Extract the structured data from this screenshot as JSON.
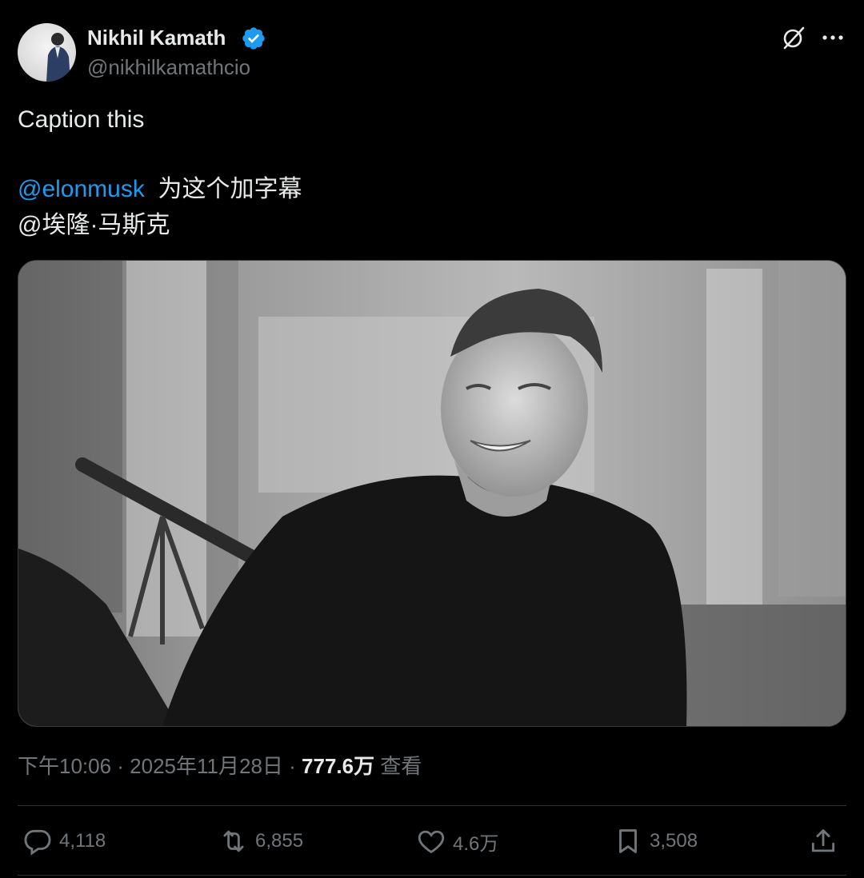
{
  "author": {
    "name": "Nikhil Kamath",
    "handle": "@nikhilkamathcio",
    "verified": true
  },
  "tweet": {
    "line1": "Caption this",
    "mention": "@elonmusk",
    "translation": "为这个加字幕",
    "line3": "@埃隆·马斯克"
  },
  "meta": {
    "time": "下午10:06 · 2025年11月28日 · ",
    "views": "777.6万",
    "views_label": " 查看"
  },
  "actions": {
    "replies": "4,118",
    "reposts": "6,855",
    "likes": "4.6万",
    "bookmarks": "3,508"
  },
  "colors": {
    "background": "#000000",
    "text": "#e7e9ea",
    "muted": "#71767b",
    "accent": "#1d9bf0",
    "divider": "#2f3336"
  },
  "icons": [
    "grok-icon",
    "more-icon",
    "verified-badge-icon",
    "reply-icon",
    "repost-icon",
    "like-icon",
    "bookmark-icon",
    "share-icon"
  ]
}
